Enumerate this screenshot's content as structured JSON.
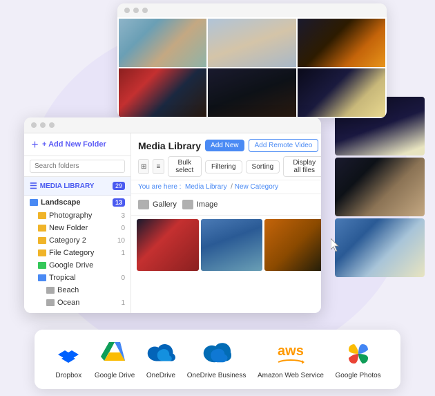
{
  "app": {
    "title": "Media Library"
  },
  "topWindow": {
    "photos": [
      "aerial",
      "crowd",
      "fire",
      "temple",
      "dark",
      "stars"
    ]
  },
  "sidebar": {
    "add_folder_label": "+ Add New Folder",
    "search_placeholder": "Search folders",
    "media_library_label": "MEDIA LIBRARY",
    "media_library_count": "29",
    "landscape_label": "Landscape",
    "landscape_count": "13",
    "items": [
      {
        "label": "Photography",
        "count": "3",
        "level": "child",
        "color": "yellow"
      },
      {
        "label": "New Folder",
        "count": "0",
        "level": "child",
        "color": "yellow"
      },
      {
        "label": "Category 2",
        "count": "10",
        "level": "child",
        "color": "yellow"
      },
      {
        "label": "File Category",
        "count": "1",
        "level": "child",
        "color": "yellow"
      },
      {
        "label": "Google Drive",
        "count": "",
        "level": "child",
        "color": "green"
      },
      {
        "label": "Tropical",
        "count": "0",
        "level": "child",
        "color": "blue"
      },
      {
        "label": "Beach",
        "count": "",
        "level": "grandchild",
        "color": "gray"
      },
      {
        "label": "Ocean",
        "count": "1",
        "level": "grandchild",
        "color": "gray"
      }
    ]
  },
  "panel": {
    "title": "Media Library",
    "add_new_label": "Add New",
    "add_remote_label": "Add Remote Video",
    "bulk_select_label": "Bulk select",
    "filtering_label": "Filtering",
    "sorting_label": "Sorting",
    "display_all_label": "Display all files",
    "breadcrumb_here": "You are here :",
    "breadcrumb_media": "Media Library",
    "breadcrumb_category": "New Category",
    "folders": [
      {
        "label": "Gallery"
      },
      {
        "label": "Image"
      }
    ]
  },
  "services": [
    {
      "name": "Dropbox",
      "icon": "dropbox"
    },
    {
      "name": "Google Drive",
      "icon": "gdrive"
    },
    {
      "name": "OneDrive",
      "icon": "onedrive"
    },
    {
      "name": "OneDrive Business",
      "icon": "onedrive-business"
    },
    {
      "name": "Amazon Web Service",
      "icon": "aws"
    },
    {
      "name": "Google Photos",
      "icon": "gphotos"
    }
  ]
}
